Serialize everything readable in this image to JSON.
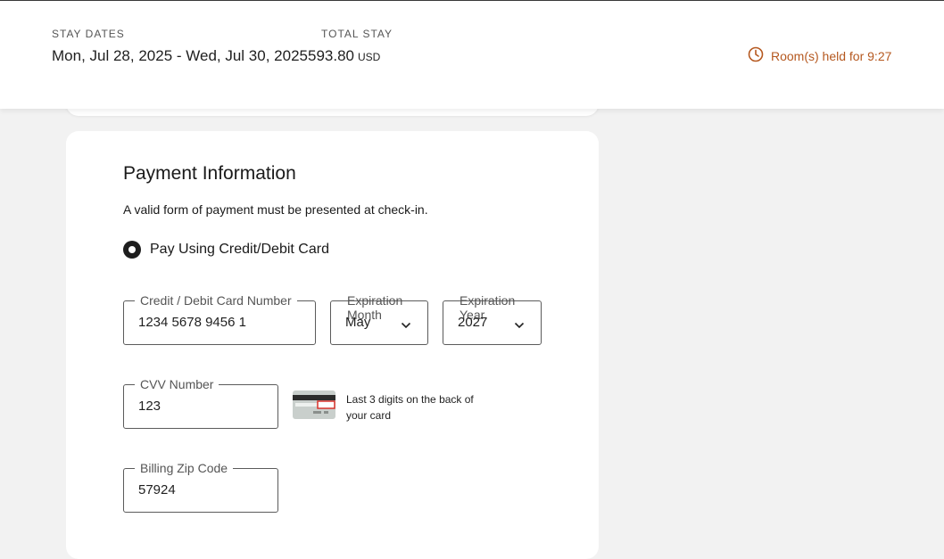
{
  "header": {
    "stay_dates_label": "STAY DATES",
    "stay_dates_value": "Mon, Jul 28, 2025 - Wed, Jul 30, 2025",
    "total_stay_label": "TOTAL STAY",
    "total_stay_amount": "593.80",
    "total_stay_currency": "USD",
    "hold_text": "Room(s) held for 9:27",
    "hold_icon": "clock-icon",
    "accent_color": "#b5581f"
  },
  "payment": {
    "title": "Payment Information",
    "subtitle": "A valid form of payment must be presented at check-in.",
    "method_label": "Pay Using Credit/Debit Card",
    "card_number": {
      "label": "Credit / Debit Card Number",
      "value": "1234 5678 9456 1"
    },
    "exp_month": {
      "label": "Expiration Month",
      "value": "May"
    },
    "exp_year": {
      "label": "Expiration Year",
      "value": "2027"
    },
    "cvv": {
      "label": "CVV Number",
      "value": "123"
    },
    "cvv_hint": "Last 3 digits on the back of your card",
    "zip": {
      "label": "Billing Zip Code",
      "value": "57924"
    }
  }
}
